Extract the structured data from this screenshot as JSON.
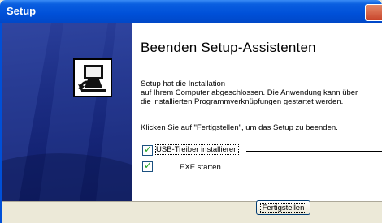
{
  "window": {
    "title": "Setup",
    "icons": {
      "close": "close-icon",
      "logo": "computer-install-icon"
    }
  },
  "content": {
    "heading": "Beenden Setup-Assistenten",
    "para1_line1": "Setup hat die Installation",
    "para1_line2": "auf Ihrem Computer abgeschlossen. Die Anwendung kann über",
    "para1_line3": "die installierten Programmverknüpfungen gestartet werden.",
    "para2": "Klicken Sie auf \"Fertigstellen\", um das Setup zu beenden.",
    "options": [
      {
        "label": "USB-Treiber installieren",
        "checked": true
      },
      {
        "label": ". . . . . .EXE starten",
        "checked": true
      }
    ]
  },
  "buttons": {
    "finish": "Fertigstellen"
  },
  "colors": {
    "titlebar": "#0050d8",
    "sidebar": "#1d2f86",
    "check": "#21a121"
  }
}
